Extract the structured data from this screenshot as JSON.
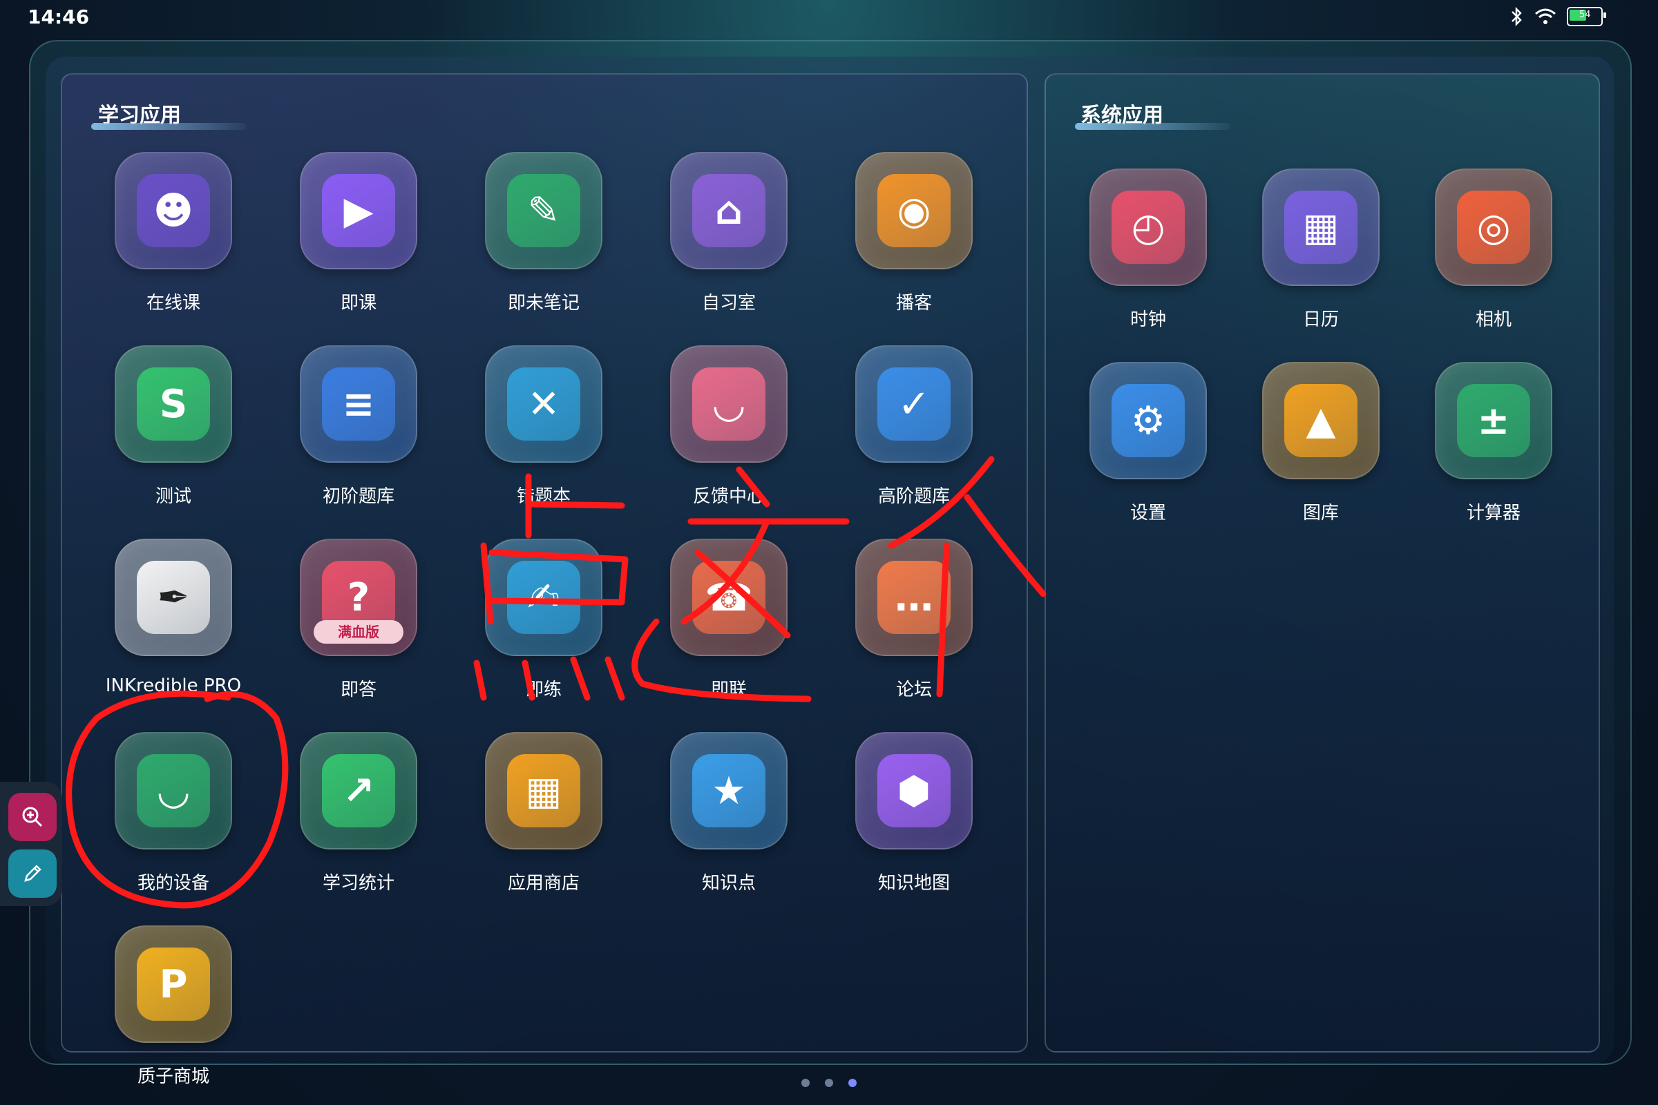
{
  "status_bar": {
    "time": "14:46",
    "battery": "54",
    "icons": [
      "bluetooth-icon",
      "wifi-icon",
      "battery-icon"
    ]
  },
  "learning_apps": {
    "title": "学习应用",
    "apps": [
      {
        "label": "在线课",
        "icon": "online-class-icon",
        "color": "#6a4fc8"
      },
      {
        "label": "即课",
        "icon": "play-icon",
        "color": "#8b5cf6"
      },
      {
        "label": "即未笔记",
        "icon": "note-icon",
        "color": "#2eaa6c"
      },
      {
        "label": "自习室",
        "icon": "study-room-icon",
        "color": "#8a60d6"
      },
      {
        "label": "播客",
        "icon": "podcast-icon",
        "color": "#f0922a"
      },
      {
        "label": "测试",
        "icon": "test-icon",
        "color": "#34c26e"
      },
      {
        "label": "初阶题库",
        "icon": "books-icon",
        "color": "#3a7de0"
      },
      {
        "label": "错题本",
        "icon": "wrong-notebook-icon",
        "color": "#2f9ed6"
      },
      {
        "label": "反馈中心",
        "icon": "headset-icon",
        "color": "#e86a8a"
      },
      {
        "label": "高阶题库",
        "icon": "graduation-cap-icon",
        "color": "#3a8de8"
      },
      {
        "label": "INKredible PRO",
        "icon": "pen-icon",
        "color": "#f2f2f2"
      },
      {
        "label": "即答",
        "icon": "question-icon",
        "color": "#e8506a",
        "badge": "满血版"
      },
      {
        "label": "即练",
        "icon": "practice-icon",
        "color": "#2f9ed6"
      },
      {
        "label": "即联",
        "icon": "contact-icon",
        "color": "#e86a4a"
      },
      {
        "label": "论坛",
        "icon": "chat-bubble-icon",
        "color": "#f07a4a"
      },
      {
        "label": "我的设备",
        "icon": "device-icon",
        "color": "#2eaa6c"
      },
      {
        "label": "学习统计",
        "icon": "trend-icon",
        "color": "#34c26e"
      },
      {
        "label": "应用商店",
        "icon": "app-store-icon",
        "color": "#f0a020"
      },
      {
        "label": "知识点",
        "icon": "bulb-star-icon",
        "color": "#3a9de8"
      },
      {
        "label": "知识地图",
        "icon": "hexagon-icon",
        "color": "#9a60f0"
      },
      {
        "label": "质子商城",
        "icon": "p-coin-icon",
        "color": "#f0b020"
      }
    ]
  },
  "system_apps": {
    "title": "系统应用",
    "apps": [
      {
        "label": "时钟",
        "icon": "clock-icon",
        "color": "#e8506a"
      },
      {
        "label": "日历",
        "icon": "calendar-icon",
        "color": "#7a60e0"
      },
      {
        "label": "相机",
        "icon": "camera-icon",
        "color": "#f0603a"
      },
      {
        "label": "设置",
        "icon": "settings-icon",
        "color": "#3a8de8"
      },
      {
        "label": "图库",
        "icon": "gallery-icon",
        "color": "#f0a020"
      },
      {
        "label": "计算器",
        "icon": "calculator-icon",
        "color": "#2eaa6c"
      }
    ]
  },
  "side_tools": [
    "zoom-in-icon",
    "pen-tool-icon"
  ],
  "annotation": {
    "text": "点这个",
    "color": "#ff1a1a"
  },
  "page_indicator": {
    "pages": 3,
    "active": 3
  }
}
